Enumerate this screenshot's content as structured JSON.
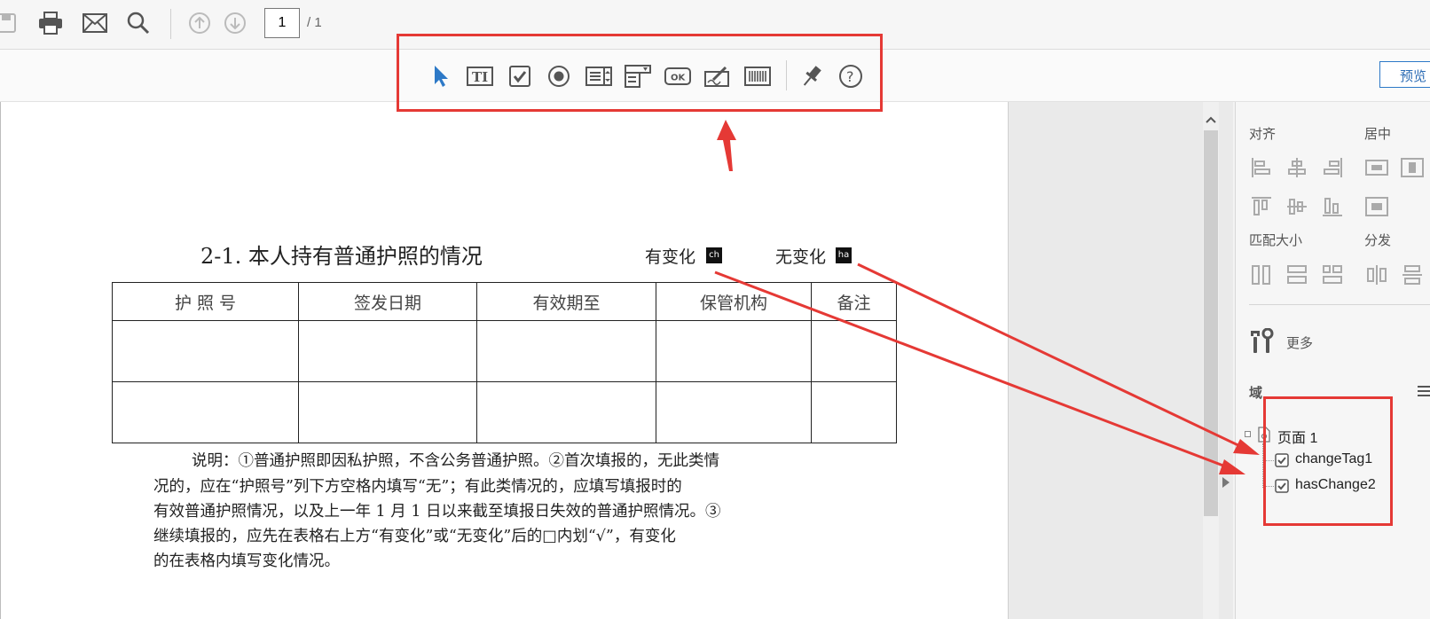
{
  "toolbar": {
    "page_current": "1",
    "page_total": "/ 1",
    "icons": [
      "save-icon",
      "print-icon",
      "email-icon",
      "search-icon",
      "page-up-icon",
      "page-down-icon"
    ]
  },
  "formbar": {
    "tools": [
      "select-tool-icon",
      "text-field-icon",
      "checkbox-icon",
      "radio-button-icon",
      "list-box-icon",
      "dropdown-icon",
      "ok-button-icon",
      "signature-icon",
      "barcode-icon",
      "pin-icon",
      "help-icon"
    ],
    "ok_label": "OK",
    "preview_label": "预览"
  },
  "document": {
    "heading": "2-1. 本人持有普通护照的情况",
    "has_change": "有变化",
    "has_change_field": "ch",
    "no_change": "无变化",
    "no_change_field": "ha",
    "table_headers": [
      "护 照 号",
      "签发日期",
      "有效期至",
      "保管机构",
      "备注"
    ],
    "table_rows": [
      [
        "",
        "",
        "",
        "",
        ""
      ],
      [
        "",
        "",
        "",
        "",
        ""
      ]
    ],
    "note_lines": [
      "说明：①普通护照即因私护照，不含公务普通护照。②首次填报的，无此类情",
      "况的，应在“护照号”列下方空格内填写“无”；有此类情况的，应填写填报时的",
      "有效普通护照情况，以及上一年 1 月 1 日以来截至填报日失效的普通护照情况。③",
      "继续填报的，应先在表格右上方“有变化”或“无变化”后的□内划“√”，有变化",
      "的在表格内填写变化情况。"
    ]
  },
  "rightpanel": {
    "align_label": "对齐",
    "center_label": "居中",
    "match_size_label": "匹配大小",
    "distribute_label": "分发",
    "more_label": "更多",
    "fields_label": "域",
    "tree": {
      "page": "页面 1",
      "fields": [
        "changeTag1",
        "hasChange2"
      ]
    }
  },
  "colors": {
    "annotation_red": "#e53935",
    "accent_blue": "#2d79c7"
  }
}
